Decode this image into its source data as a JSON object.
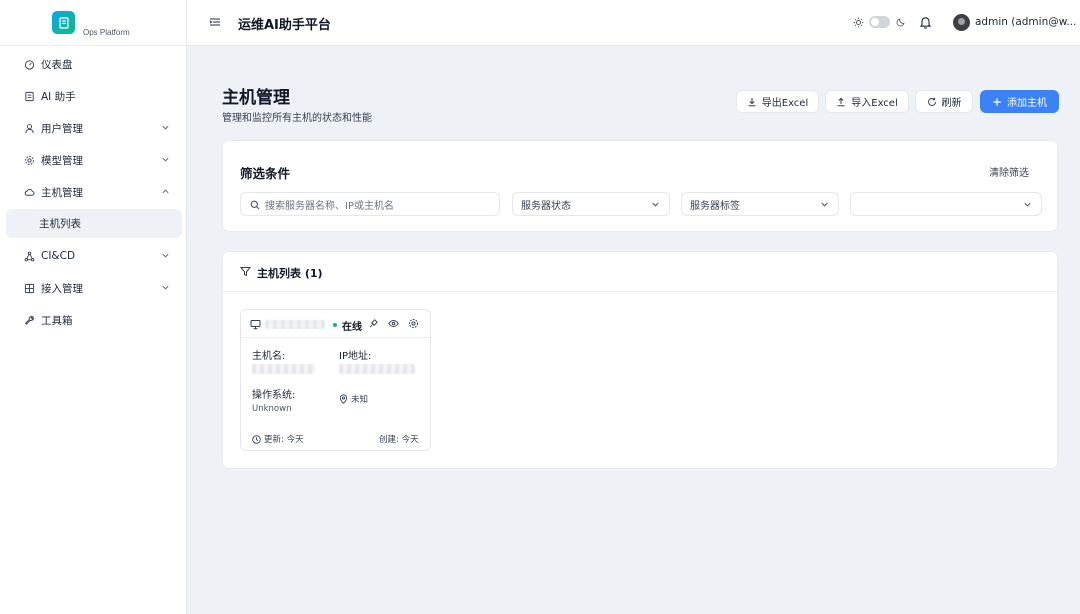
{
  "brand": {
    "name": "Ops Platform",
    "logo_icon": "server-box-icon"
  },
  "sidebar": {
    "items": [
      {
        "label": "仪表盘",
        "icon": "dashboard-icon"
      },
      {
        "label": "AI 助手",
        "icon": "bot-icon"
      },
      {
        "label": "用户管理",
        "icon": "user-icon",
        "expandable": true
      },
      {
        "label": "模型管理",
        "icon": "gear-icon",
        "expandable": true
      },
      {
        "label": "主机管理",
        "icon": "cloud-icon",
        "expanded": true,
        "sub": [
          {
            "label": "主机列表",
            "active": true
          }
        ]
      },
      {
        "label": "CI&CD",
        "icon": "network-icon",
        "expandable": true
      },
      {
        "label": "接入管理",
        "icon": "grid-icon",
        "expandable": true
      },
      {
        "label": "工具箱",
        "icon": "wrench-icon"
      }
    ]
  },
  "header": {
    "title": "运维AI助手平台",
    "user": "admin (admin@w..."
  },
  "page": {
    "title": "主机管理",
    "subtitle": "管理和监控所有主机的状态和性能",
    "actions": {
      "export": "导出Excel",
      "import": "导入Excel",
      "refresh": "刷新",
      "add": "添加主机"
    }
  },
  "filter": {
    "title": "筛选条件",
    "clear": "清除筛选",
    "search_placeholder": "搜索服务器名称、IP或主机名",
    "status_select": "服务器状态",
    "tag_select": "服务器标签",
    "extra_select": ""
  },
  "host_list": {
    "title": "主机列表 (1)",
    "hosts": [
      {
        "status": "在线",
        "hostname_label": "主机名:",
        "ip_label": "IP地址:",
        "os_label": "操作系统:",
        "os_value": "Unknown",
        "location": "未知",
        "updated": "更新: 今天",
        "created": "创建: 今天"
      }
    ]
  },
  "colors": {
    "primary": "#3b82f6",
    "online": "#10b981",
    "background": "#eef1f5"
  }
}
